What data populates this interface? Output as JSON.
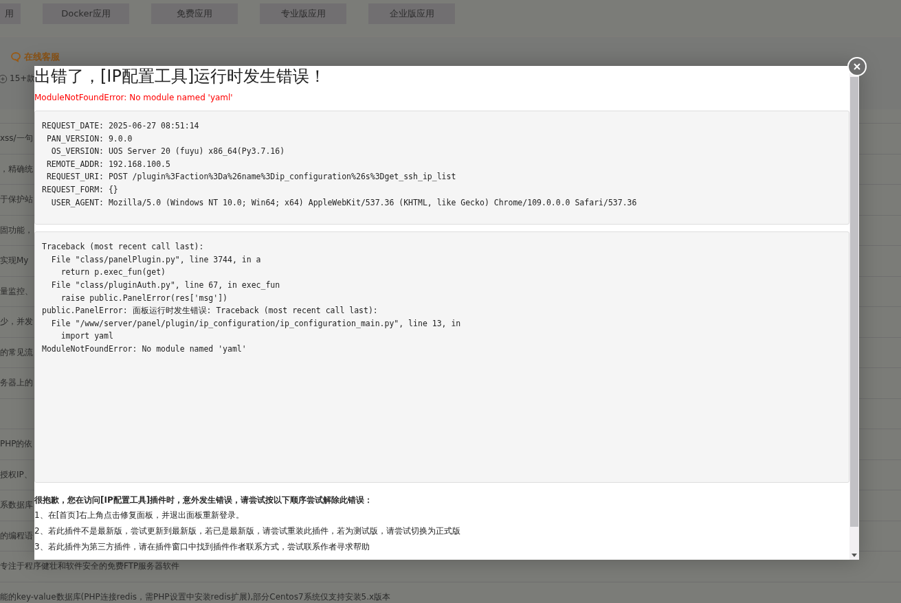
{
  "background": {
    "tabs": [
      {
        "label": "用"
      },
      {
        "label": "Docker应用"
      },
      {
        "label": "免费应用"
      },
      {
        "label": "专业版应用"
      },
      {
        "label": "企业版应用"
      }
    ],
    "support_link": "在线客服",
    "feature_note": "15+款",
    "list_rows": [
      "xss/一句",
      "，精确统",
      "于保护站",
      "固功能，",
      "实现My",
      "量监控、",
      "少，并发",
      "的常见流",
      "务器上的",
      "",
      "PHP的依",
      "授权IP、",
      "系数据库",
      "的编程语",
      "专注于程序健壮和软件安全的免费FTP服务器软件",
      "能的key-value数据库(PHP连接redis，需PHP设置中安装redis扩展),部分Centos7系统仅支持安装5.x版本"
    ]
  },
  "dialog": {
    "title": "出错了，[IP配置工具]运行时发生错误！",
    "error": "ModuleNotFoundError: No module named 'yaml'",
    "request_info": [
      "REQUEST_DATE: 2025-06-27 08:51:14",
      " PAN_VERSION: 9.0.0",
      "  OS_VERSION: UOS Server 20 (fuyu) x86_64(Py3.7.16)",
      " REMOTE_ADDR: 192.168.100.5",
      " REQUEST_URI: POST /plugin%3Faction%3Da%26name%3Dip_configuration%26s%3Dget_ssh_ip_list",
      "REQUEST_FORM: {}",
      "  USER_AGENT: Mozilla/5.0 (Windows NT 10.0; Win64; x64) AppleWebKit/537.36 (KHTML, like Gecko) Chrome/109.0.0.0 Safari/537.36"
    ],
    "traceback": [
      "Traceback (most recent call last):",
      "  File \"class/panelPlugin.py\", line 3744, in a",
      "    return p.exec_fun(get)",
      "  File \"class/pluginAuth.py\", line 67, in exec_fun",
      "    raise public.PanelError(res['msg'])",
      "public.PanelError: 面板运行时发生错误: Traceback (most recent call last):",
      "  File \"/www/server/panel/plugin/ip_configuration/ip_configuration_main.py\", line 13, in",
      "    import yaml",
      "ModuleNotFoundError: No module named 'yaml'"
    ],
    "help_title": "很抱歉，您在访问[IP配置工具]插件时，意外发生错误，请尝试按以下顺序尝试解除此错误：",
    "help_steps": [
      "1、在[首页]右上角点击修复面板，并退出面板重新登录。",
      "2、若此插件不是最新版，尝试更新到最新版，若已是最新版，请尝试重装此插件，若为测试版，请尝试切换为正式版",
      "3、若此插件为第三方插件，请在插件窗口中找到插件作者联系方式，尝试联系作者寻求帮助"
    ]
  }
}
